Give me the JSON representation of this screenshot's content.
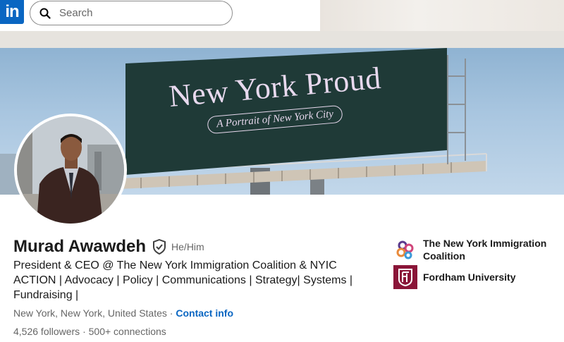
{
  "nav": {
    "logo_text": "in",
    "search_placeholder": "Search"
  },
  "banner": {
    "title": "New York Proud",
    "subtitle": "A Portrait of New York City"
  },
  "profile": {
    "name": "Murad Awawdeh",
    "pronouns": "He/Him",
    "headline": "President & CEO @ The New York Immigration Coalition & NYIC ACTION | Advocacy | Policy | Communications | Strategy| Systems | Fundraising |",
    "location": "New York, New York, United States",
    "separator": "·",
    "contact_info": "Contact info",
    "followers": "4,526 followers",
    "connections": "500+ connections"
  },
  "organizations": [
    {
      "name": "The New York Immigration Coalition",
      "logo": "nyic-logo"
    },
    {
      "name": "Fordham University",
      "logo": "fordham-logo"
    }
  ],
  "colors": {
    "brand_blue": "#0a66c2",
    "fordham_maroon": "#8a1538"
  }
}
